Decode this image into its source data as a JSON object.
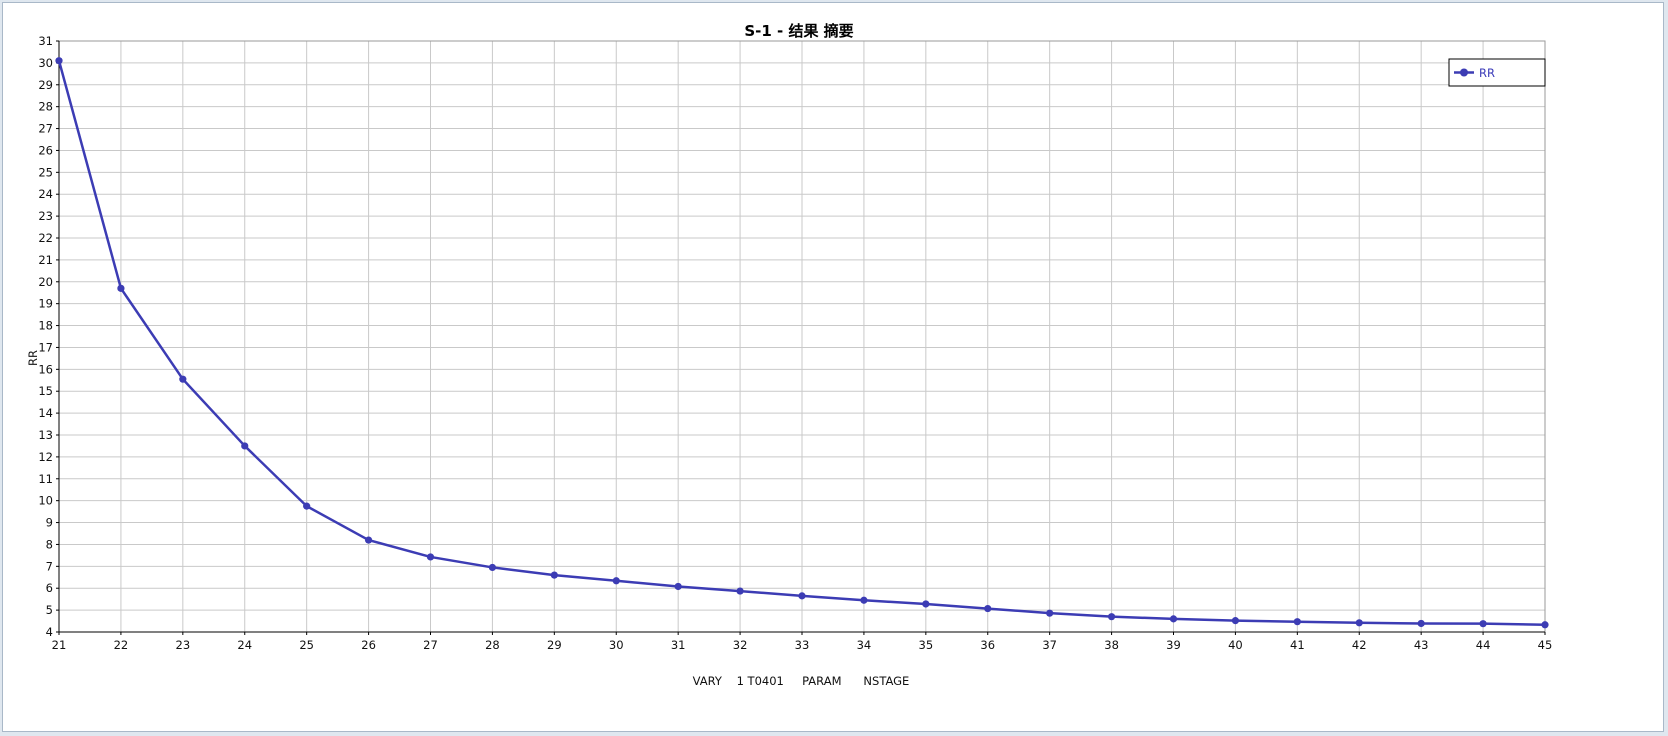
{
  "chart_data": {
    "type": "line",
    "title": "S-1 - 结果 摘要",
    "xlabel": "VARY    1 T0401     PARAM      NSTAGE",
    "ylabel": "RR",
    "xlim": [
      21,
      45
    ],
    "ylim": [
      4,
      31
    ],
    "x_ticks": [
      21,
      22,
      23,
      24,
      25,
      26,
      27,
      28,
      29,
      30,
      31,
      32,
      33,
      34,
      35,
      36,
      37,
      38,
      39,
      40,
      41,
      42,
      43,
      44,
      45
    ],
    "y_ticks": [
      4,
      5,
      6,
      7,
      8,
      9,
      10,
      11,
      12,
      13,
      14,
      15,
      16,
      17,
      18,
      19,
      20,
      21,
      22,
      23,
      24,
      25,
      26,
      27,
      28,
      29,
      30,
      31
    ],
    "grid": true,
    "legend_position": "top-right",
    "series": [
      {
        "name": "RR",
        "color": "#3c3cb4",
        "marker": "circle",
        "x": [
          21,
          22,
          23,
          24,
          25,
          26,
          27,
          28,
          29,
          30,
          31,
          32,
          33,
          34,
          35,
          36,
          37,
          38,
          39,
          40,
          41,
          42,
          43,
          44,
          45
        ],
        "y": [
          30.1,
          19.7,
          15.55,
          12.5,
          9.75,
          8.2,
          7.43,
          6.95,
          6.6,
          6.34,
          6.08,
          5.87,
          5.65,
          5.45,
          5.28,
          5.07,
          4.86,
          4.7,
          4.6,
          4.52,
          4.47,
          4.42,
          4.39,
          4.38,
          4.33
        ]
      }
    ]
  }
}
